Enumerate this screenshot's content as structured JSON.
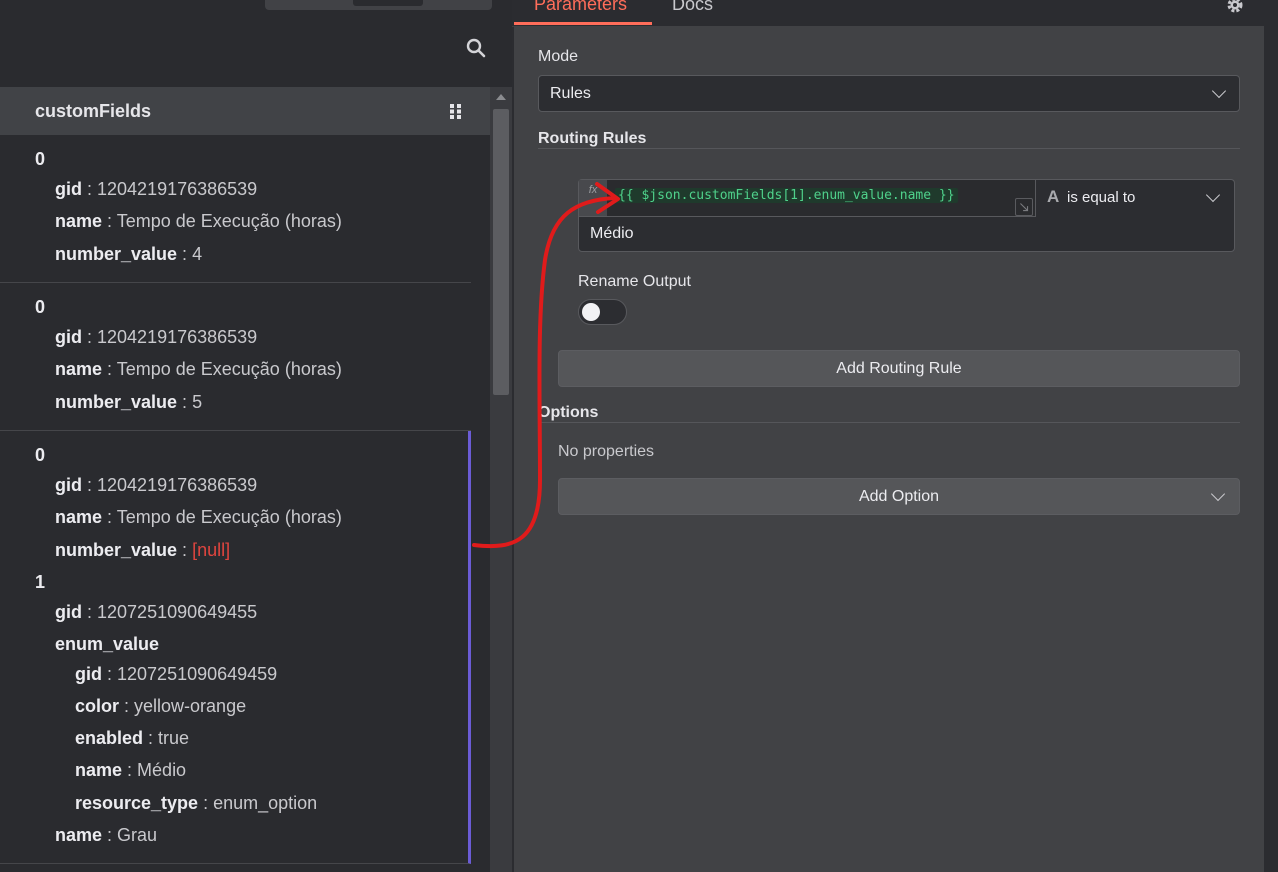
{
  "left_panel": {
    "column_title": "customFields",
    "rows": [
      {
        "lines": [
          {
            "type": "index",
            "text": "0"
          },
          {
            "key": "gid",
            "value": "1204219176386539"
          },
          {
            "key": "name",
            "value": "Tempo de Execução (horas)"
          },
          {
            "key": "number_value",
            "value": "4"
          }
        ]
      },
      {
        "lines": [
          {
            "type": "index",
            "text": "0"
          },
          {
            "key": "gid",
            "value": "1204219176386539"
          },
          {
            "key": "name",
            "value": "Tempo de Execução (horas)"
          },
          {
            "key": "number_value",
            "value": "5"
          }
        ]
      },
      {
        "lines": [
          {
            "type": "index",
            "text": "0"
          },
          {
            "key": "gid",
            "value": "1204219176386539"
          },
          {
            "key": "name",
            "value": "Tempo de Execução (horas)"
          },
          {
            "key": "number_value",
            "value": "[null]",
            "is_null": true
          },
          {
            "type": "index",
            "text": "1"
          },
          {
            "key": "gid",
            "value": "1207251090649455"
          },
          {
            "key": "enum_value",
            "value": ""
          },
          {
            "key": "gid",
            "value": "1207251090649459",
            "nested": true
          },
          {
            "key": "color",
            "value": "yellow-orange",
            "nested": true
          },
          {
            "key": "enabled",
            "value": "true",
            "nested": true
          },
          {
            "key": "name",
            "value": "Médio",
            "nested": true
          },
          {
            "key": "resource_type",
            "value": "enum_option",
            "nested": true
          },
          {
            "key": "name",
            "value": "Grau"
          }
        ]
      }
    ]
  },
  "right_panel": {
    "tabs": {
      "parameters": "Parameters",
      "docs": "Docs"
    },
    "mode": {
      "label": "Mode",
      "value": "Rules"
    },
    "routing_rules": {
      "label": "Routing Rules",
      "fx_badge": "fx",
      "expression": "{{ $json.customFields[1].enum_value.name }}",
      "type_icon": "A",
      "operator": "is equal to",
      "value": "Médio",
      "rename_label": "Rename Output",
      "add_rule_button": "Add Routing Rule"
    },
    "options": {
      "label": "Options",
      "no_properties": "No properties",
      "add_option_button": "Add Option"
    }
  },
  "colors": {
    "accent": "#ff6d5a",
    "expression": "#4fd18b",
    "null": "#e0453f",
    "selected_border": "#6b5cd6",
    "annotation_arrow": "#e01b1b"
  }
}
